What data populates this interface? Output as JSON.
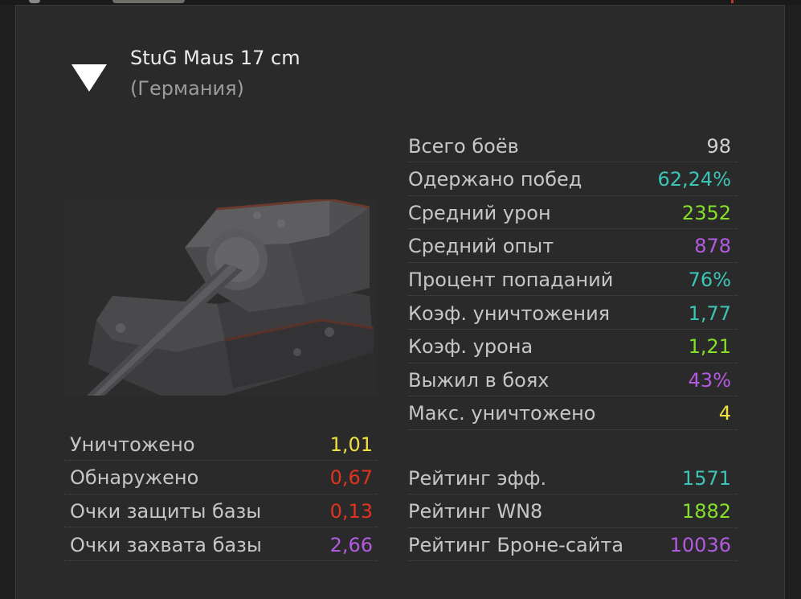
{
  "vehicle": {
    "name": "StuG Maus 17 cm",
    "nation": "(Германия)"
  },
  "stats_main": [
    {
      "label": "Всего боёв",
      "value": "98",
      "color": "#d0d0d0"
    },
    {
      "label": "Одержано побед",
      "value": "62,24%",
      "color": "#3cc4b6"
    },
    {
      "label": "Средний урон",
      "value": "2352",
      "color": "#86e02a"
    },
    {
      "label": "Средний опыт",
      "value": "878",
      "color": "#b35be0"
    },
    {
      "label": "Процент попаданий",
      "value": "76%",
      "color": "#3cc4b6"
    },
    {
      "label": "Коэф. уничтожения",
      "value": "1,77",
      "color": "#3cc4b6"
    },
    {
      "label": "Коэф. урона",
      "value": "1,21",
      "color": "#86e02a"
    },
    {
      "label": "Выжил в боях",
      "value": "43%",
      "color": "#b35be0"
    },
    {
      "label": "Макс. уничтожено",
      "value": "4",
      "color": "#f0e040"
    }
  ],
  "stats_avg": [
    {
      "label": "Уничтожено",
      "value": "1,01",
      "color": "#f0e040"
    },
    {
      "label": "Обнаружено",
      "value": "0,67",
      "color": "#e0341e"
    },
    {
      "label": "Очки защиты базы",
      "value": "0,13",
      "color": "#e0341e"
    },
    {
      "label": "Очки захвата базы",
      "value": "2,66",
      "color": "#b35be0"
    }
  ],
  "ratings": [
    {
      "label": "Рейтинг эфф.",
      "value": "1571",
      "color": "#3cc4b6"
    },
    {
      "label": "Рейтинг WN8",
      "value": "1882",
      "color": "#86e02a"
    },
    {
      "label": "Рейтинг Броне-сайта",
      "value": "10036",
      "color": "#b35be0"
    }
  ],
  "icons": {
    "collapse": "collapse-triangle-icon",
    "vehicle_image": "tank-image"
  }
}
